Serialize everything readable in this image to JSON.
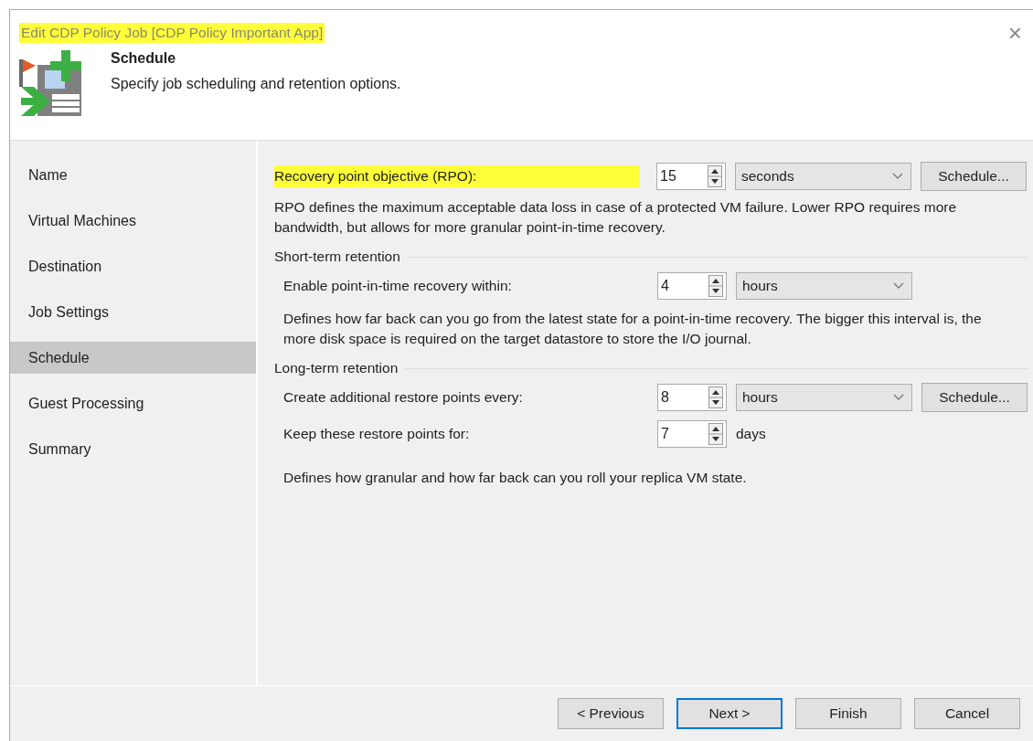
{
  "window": {
    "title": "Edit CDP Policy Job [CDP Policy Important App]",
    "highlighted": true,
    "close": "×"
  },
  "header": {
    "title": "Schedule",
    "subtitle": "Specify job scheduling and retention options."
  },
  "steps": [
    {
      "label": "Name",
      "selected": false
    },
    {
      "label": "Virtual Machines",
      "selected": false
    },
    {
      "label": "Destination",
      "selected": false
    },
    {
      "label": "Job Settings",
      "selected": false
    },
    {
      "label": "Schedule",
      "selected": true
    },
    {
      "label": "Guest Processing",
      "selected": false
    },
    {
      "label": "Summary",
      "selected": false
    }
  ],
  "rpo": {
    "label": "Recovery point objective (RPO):",
    "highlighted": true,
    "value": "15",
    "unit": "seconds",
    "button": "Schedule...",
    "note": "RPO defines the maximum acceptable data loss in case of a protected VM failure. Lower RPO requires more bandwidth, but allows for more granular point-in-time recovery."
  },
  "sections": [
    {
      "title": "Short-term retention",
      "rows": [
        {
          "kind": "select",
          "label": "Enable point-in-time recovery within:",
          "value": "4",
          "unit": "hours"
        }
      ],
      "note": "Defines how far back can you go from the latest state for a point-in-time recovery. The bigger this interval is, the more disk space is required on the target datastore to store the I/O journal."
    },
    {
      "title": "Long-term retention",
      "rows": [
        {
          "kind": "select",
          "label": "Create additional restore points every:",
          "value": "8",
          "unit": "hours",
          "button": "Schedule..."
        },
        {
          "kind": "text",
          "label": "Keep these restore points for:",
          "value": "7",
          "unit": "days"
        }
      ],
      "note": "Defines how granular and how far back can you roll your replica VM state."
    }
  ],
  "buttons": [
    {
      "label": "< Previous",
      "default": false
    },
    {
      "label": "Next >",
      "default": true
    },
    {
      "label": "Finish",
      "default": false
    },
    {
      "label": "Cancel",
      "default": false
    }
  ]
}
